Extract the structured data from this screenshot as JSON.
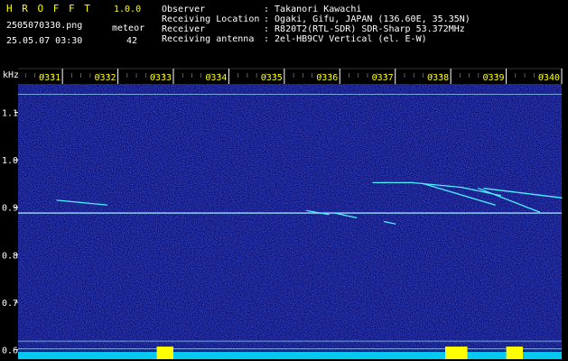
{
  "header": {
    "app_name": "H R O F F T",
    "version": "1.0.0",
    "filename": "2505070330.png",
    "meteor_label": "meteor",
    "meteor_count": "42",
    "datetime": "25.05.07 03:30",
    "info_labels": [
      "Observer",
      "Receiving Location",
      "Receiver",
      "Receiving antenna"
    ],
    "info_values": [
      ": Takanori Kawachi",
      ": Ogaki, Gifu, JAPAN (136.60E, 35.35N)",
      ": R820T2(RTL-SDR) SDR-Sharp 53.372MHz",
      ": 2el-HB9CV Vertical (el. E-W)"
    ]
  },
  "chart_data": {
    "type": "heatmap",
    "ylabel": "kHz",
    "x_ticks": [
      "0331",
      "0332",
      "0333",
      "0334",
      "0335",
      "0336",
      "0337",
      "0338",
      "0339",
      "0340"
    ],
    "y_ticks": [
      "1.1",
      "1.0",
      "0.9",
      "0.8",
      "0.7",
      "0.6"
    ],
    "y_tick_values": [
      1.1,
      1.0,
      0.9,
      0.8,
      0.7,
      0.6
    ],
    "ylim": [
      0.58,
      1.16
    ],
    "xlim_minutes": [
      30.2,
      40.0
    ],
    "carrier_lines": [
      0.888,
      1.138,
      0.618,
      0.602
    ],
    "meteor_traces": [
      {
        "x": [
          30.9,
          31.8
        ],
        "y": [
          0.915,
          0.905
        ]
      },
      {
        "x": [
          35.4,
          35.8
        ],
        "y": [
          0.893,
          0.885
        ]
      },
      {
        "x": [
          36.6,
          37.3
        ],
        "y": [
          0.952,
          0.952
        ]
      },
      {
        "x": [
          37.3,
          38.2
        ],
        "y": [
          0.952,
          0.942
        ]
      },
      {
        "x": [
          37.5,
          38.8
        ],
        "y": [
          0.95,
          0.905
        ]
      },
      {
        "x": [
          38.2,
          38.9
        ],
        "y": [
          0.942,
          0.925
        ]
      },
      {
        "x": [
          38.5,
          39.6
        ],
        "y": [
          0.94,
          0.89
        ]
      },
      {
        "x": [
          38.6,
          40.0
        ],
        "y": [
          0.94,
          0.92
        ]
      },
      {
        "x": [
          35.9,
          36.3
        ],
        "y": [
          0.888,
          0.878
        ]
      },
      {
        "x": [
          36.8,
          37.0
        ],
        "y": [
          0.87,
          0.865
        ]
      }
    ],
    "colors": {
      "background": "#0a0a6a",
      "carrier": "#9fdcff",
      "trace": "#4ff0ff",
      "tick_label": "#ffff00",
      "grid_tick": "#ffffff",
      "activity_bar": "#00e5ff",
      "activity_peak": "#ffff00"
    }
  }
}
